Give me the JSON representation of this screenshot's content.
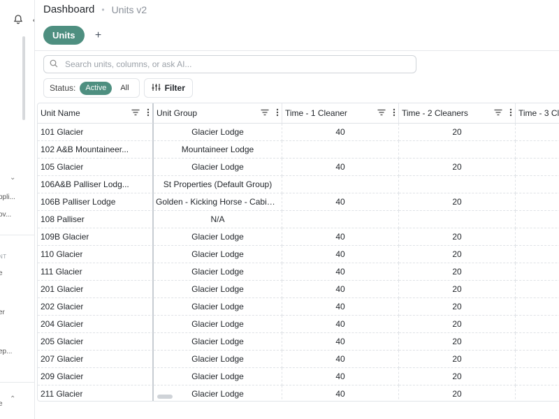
{
  "sidebar": {
    "fragments": [
      "ppli...",
      "ov...",
      "NT",
      "e",
      "er",
      "ep...",
      "e"
    ]
  },
  "breadcrumb": {
    "home": "Dashboard",
    "current": "Units v2"
  },
  "tabs": {
    "active": "Units",
    "add": "+"
  },
  "search": {
    "placeholder": "Search units, columns, or ask AI...",
    "value": ""
  },
  "filters": {
    "status_label": "Status:",
    "active": "Active",
    "all": "All",
    "filter": "Filter"
  },
  "table": {
    "columns": [
      "Unit Name",
      "Unit Group",
      "Time - 1 Cleaner",
      "Time - 2 Cleaners",
      "Time - 3 Cle"
    ],
    "rows": [
      [
        "101 Glacier",
        "Glacier Lodge",
        "40",
        "20",
        ""
      ],
      [
        "102 A&B Mountaineer...",
        "Mountaineer Lodge",
        "",
        "",
        ""
      ],
      [
        "105 Glacier",
        "Glacier Lodge",
        "40",
        "20",
        ""
      ],
      [
        "106A&B Palliser Lodg...",
        "St Properties (Default Group)",
        "",
        "",
        ""
      ],
      [
        "106B Palliser Lodge",
        "Golden - Kicking Horse - Cabin ...",
        "40",
        "20",
        ""
      ],
      [
        "108 Palliser",
        "N/A",
        "",
        "",
        ""
      ],
      [
        "109B Glacier",
        "Glacier Lodge",
        "40",
        "20",
        ""
      ],
      [
        "110 Glacier",
        "Glacier Lodge",
        "40",
        "20",
        ""
      ],
      [
        "111 Glacier",
        "Glacier Lodge",
        "40",
        "20",
        ""
      ],
      [
        "201 Glacier",
        "Glacier Lodge",
        "40",
        "20",
        ""
      ],
      [
        "202 Glacier",
        "Glacier Lodge",
        "40",
        "20",
        ""
      ],
      [
        "204 Glacier",
        "Glacier Lodge",
        "40",
        "20",
        ""
      ],
      [
        "205 Glacier",
        "Glacier Lodge",
        "40",
        "20",
        ""
      ],
      [
        "207 Glacier",
        "Glacier Lodge",
        "40",
        "20",
        ""
      ],
      [
        "209 Glacier",
        "Glacier Lodge",
        "40",
        "20",
        ""
      ],
      [
        "211 Glacier",
        "Glacier Lodge",
        "40",
        "20",
        ""
      ]
    ]
  },
  "colors": {
    "accent": "#4e8f80",
    "border": "#e1e4e8"
  }
}
